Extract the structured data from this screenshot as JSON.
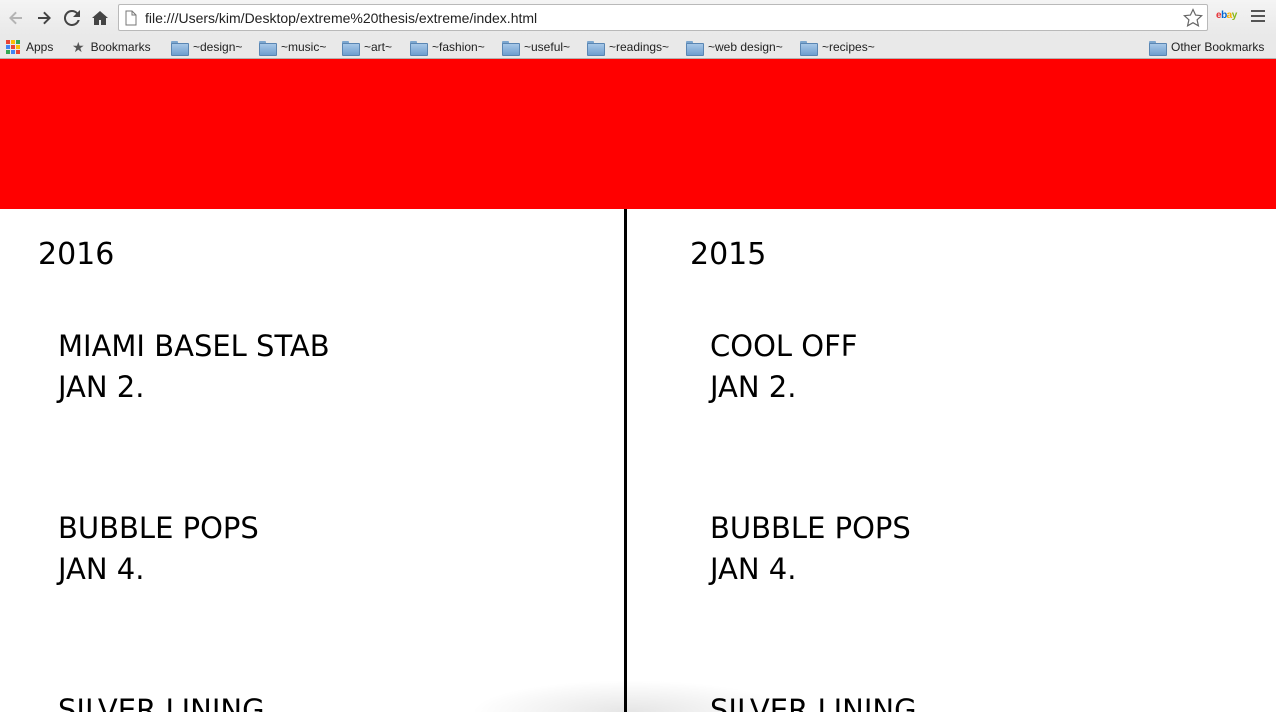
{
  "browser": {
    "url": "file:///Users/kim/Desktop/extreme%20thesis/extreme/index.html",
    "extension_label": "ebay"
  },
  "bookmarks": [
    {
      "label": "Apps",
      "icon": "apps-grid-icon"
    },
    {
      "label": "Bookmarks",
      "icon": "star-icon"
    },
    {
      "label": "~design~",
      "icon": "folder-icon"
    },
    {
      "label": "~music~",
      "icon": "folder-icon"
    },
    {
      "label": "~art~",
      "icon": "folder-icon"
    },
    {
      "label": "~fashion~",
      "icon": "folder-icon"
    },
    {
      "label": "~useful~",
      "icon": "folder-icon"
    },
    {
      "label": "~readings~",
      "icon": "folder-icon"
    },
    {
      "label": "~web design~",
      "icon": "folder-icon"
    },
    {
      "label": "~recipes~",
      "icon": "folder-icon"
    },
    {
      "label": "Other Bookmarks",
      "icon": "folder-icon"
    }
  ],
  "page": {
    "hero_color": "#ff0000",
    "columns": [
      {
        "year": "2016",
        "events": [
          {
            "title": "MIAMI BASEL STAB",
            "date": "JAN 2."
          },
          {
            "title": "BUBBLE POPS",
            "date": "JAN 4."
          },
          {
            "title": "SILVER LINING",
            "date": ""
          }
        ]
      },
      {
        "year": "2015",
        "events": [
          {
            "title": "COOL OFF",
            "date": "JAN 2."
          },
          {
            "title": "BUBBLE POPS",
            "date": "JAN 4."
          },
          {
            "title": "SILVER LINING",
            "date": ""
          }
        ]
      }
    ]
  }
}
